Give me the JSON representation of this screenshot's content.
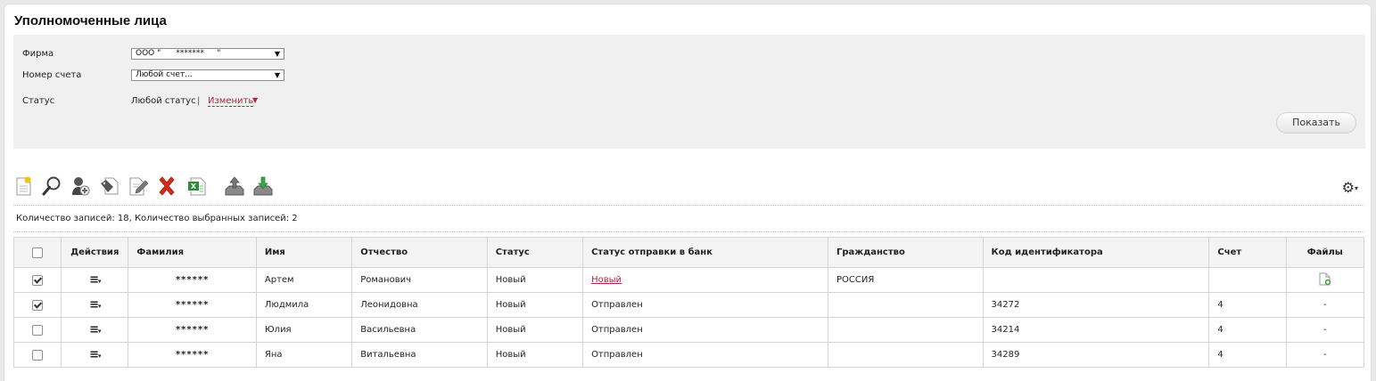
{
  "page": {
    "title": "Уполномоченные лица"
  },
  "filters": {
    "firm_label": "Фирма",
    "firm_value": "ООО \"      *******     \"",
    "account_label": "Номер счета",
    "account_value": "Любой счет...",
    "status_label": "Статус",
    "status_value": "Любой статус",
    "status_separator": "|",
    "change_label": "Изменить",
    "show_button": "Показать"
  },
  "toolbar": {
    "icons": [
      "new-document-icon",
      "search-magnifier-icon",
      "add-person-icon",
      "tag-document-icon",
      "edit-document-icon",
      "delete-cross-icon",
      "excel-export-icon",
      "upload-tray-icon",
      "download-tray-icon"
    ],
    "settings_icon": "gear-icon"
  },
  "summary": {
    "text": "Количество записей: 18, Количество выбранных записей: 2"
  },
  "table": {
    "columns": [
      "",
      "Действия",
      "Фамилия",
      "Имя",
      "Отчество",
      "Статус",
      "Статус отправки в банк",
      "Гражданство",
      "Код идентификатора",
      "Счет",
      "Файлы"
    ],
    "rows": [
      {
        "checked": true,
        "surname": "******",
        "name": "Артем",
        "patronymic": "Романович",
        "status": "Новый",
        "bank_status": "Новый",
        "bank_status_link": true,
        "citizenship": "РОССИЯ",
        "id_code": "",
        "account": "",
        "files": ""
      },
      {
        "checked": true,
        "surname": "******",
        "name": "Людмила",
        "patronymic": "Леонидовна",
        "status": "Новый",
        "bank_status": "Отправлен",
        "bank_status_link": false,
        "citizenship": "",
        "id_code": "34272",
        "account": "4",
        "files": "-"
      },
      {
        "checked": false,
        "surname": "******",
        "name": "Юлия",
        "patronymic": "Васильевна",
        "status": "Новый",
        "bank_status": "Отправлен",
        "bank_status_link": false,
        "citizenship": "",
        "id_code": "34214",
        "account": "4",
        "files": "-"
      },
      {
        "checked": false,
        "surname": "******",
        "name": "Яна",
        "patronymic": "Витальевна",
        "status": "Новый",
        "bank_status": "Отправлен",
        "bank_status_link": false,
        "citizenship": "",
        "id_code": "34289",
        "account": "4",
        "files": "-"
      }
    ]
  },
  "colors": {
    "accent_link": "#b0253e",
    "filter_bg": "#f0f0f0",
    "header_bg": "#f4f4f4"
  }
}
